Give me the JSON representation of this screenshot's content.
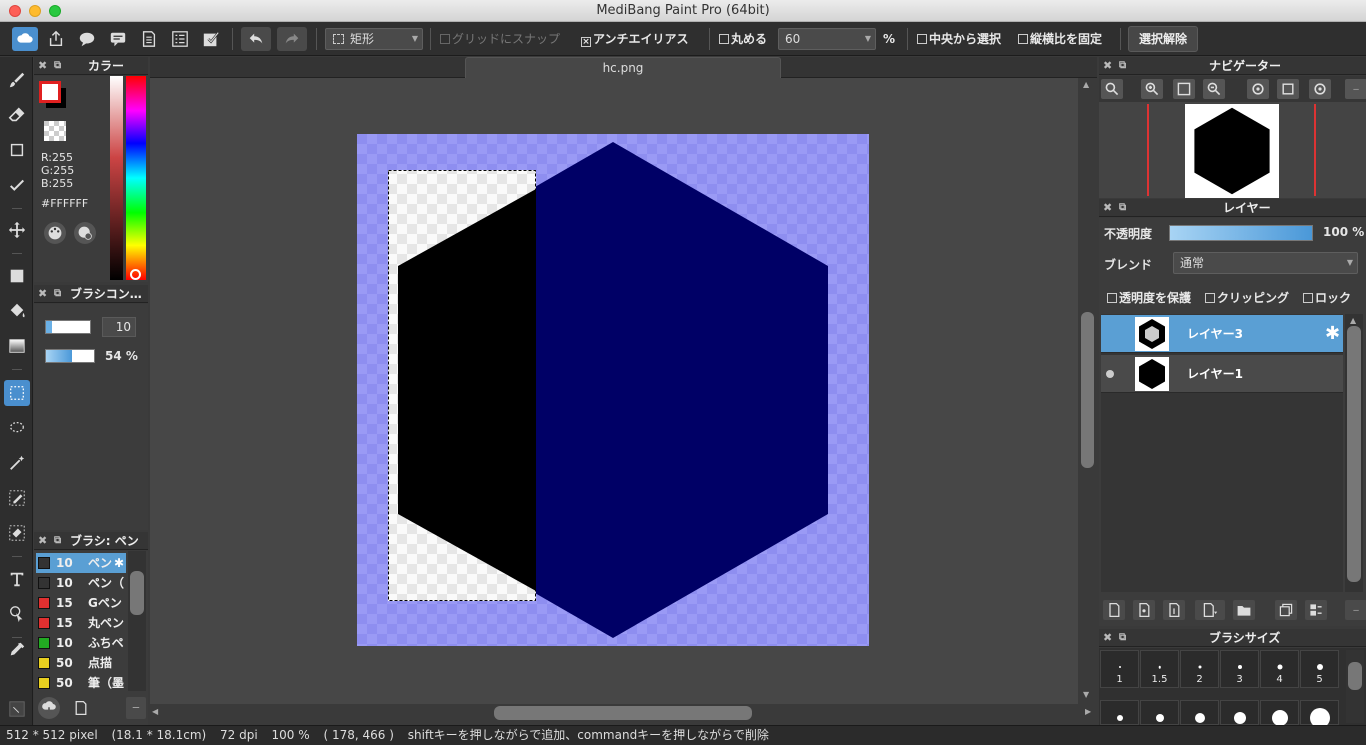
{
  "window": {
    "title": "MediBang Paint Pro (64bit)"
  },
  "toolbar": {
    "shape_select": "矩形",
    "grid_snap": "グリッドにスナップ",
    "antialias": "アンチエイリアス",
    "round": "丸める",
    "round_value": "60",
    "percent_unit": "%",
    "from_center": "中央から選択",
    "fix_ratio": "縦横比を固定",
    "deselect": "選択解除"
  },
  "document": {
    "tab_name": "hc.png"
  },
  "color_panel": {
    "title": "カラー",
    "r": "R:255",
    "g": "G:255",
    "b": "B:255",
    "hex": "#FFFFFF"
  },
  "brush_control": {
    "title": "ブラシコン…",
    "size_value": "10",
    "opacity_value": "54 %",
    "opacity_fraction": 0.54
  },
  "brush_list": {
    "title": "ブラシ: ペン",
    "items": [
      {
        "size": "10",
        "name": "ペン",
        "color": "#333333",
        "selected": true
      },
      {
        "size": "10",
        "name": "ペン（",
        "color": "#333333",
        "selected": false
      },
      {
        "size": "15",
        "name": "Gペン",
        "color": "#e03030",
        "selected": false
      },
      {
        "size": "15",
        "name": "丸ペン",
        "color": "#e03030",
        "selected": false
      },
      {
        "size": "10",
        "name": "ふちペ",
        "color": "#22aa22",
        "selected": false
      },
      {
        "size": "50",
        "name": "点描",
        "color": "#e8d020",
        "selected": false
      },
      {
        "size": "50",
        "name": "筆（墨",
        "color": "#e8d020",
        "selected": false
      }
    ]
  },
  "navigator": {
    "title": "ナビゲーター"
  },
  "layer_panel": {
    "title": "レイヤー",
    "opacity_label": "不透明度",
    "opacity_value": "100 %",
    "blend_label": "ブレンド",
    "blend_value": "通常",
    "protect_alpha": "透明度を保護",
    "clipping": "クリッピング",
    "lock": "ロック",
    "layers": [
      {
        "name": "レイヤー3",
        "selected": true
      },
      {
        "name": "レイヤー1",
        "selected": false
      }
    ]
  },
  "brush_size_panel": {
    "title": "ブラシサイズ",
    "sizes": [
      "1",
      "1.5",
      "2",
      "3",
      "4",
      "5"
    ]
  },
  "status": {
    "dimensions": "512 * 512 pixel",
    "physical": "(18.1 * 18.1cm)",
    "dpi": "72 dpi",
    "zoom": "100 %",
    "coords": "( 178, 466 )",
    "hint": "shiftキーを押しながらで追加、commandキーを押しながらで削除"
  },
  "colors": {
    "accent": "#4a8fce",
    "canvas_bg": "#9999f5",
    "hexagon": "#000066",
    "layer_selected": "#5a9fd4"
  }
}
